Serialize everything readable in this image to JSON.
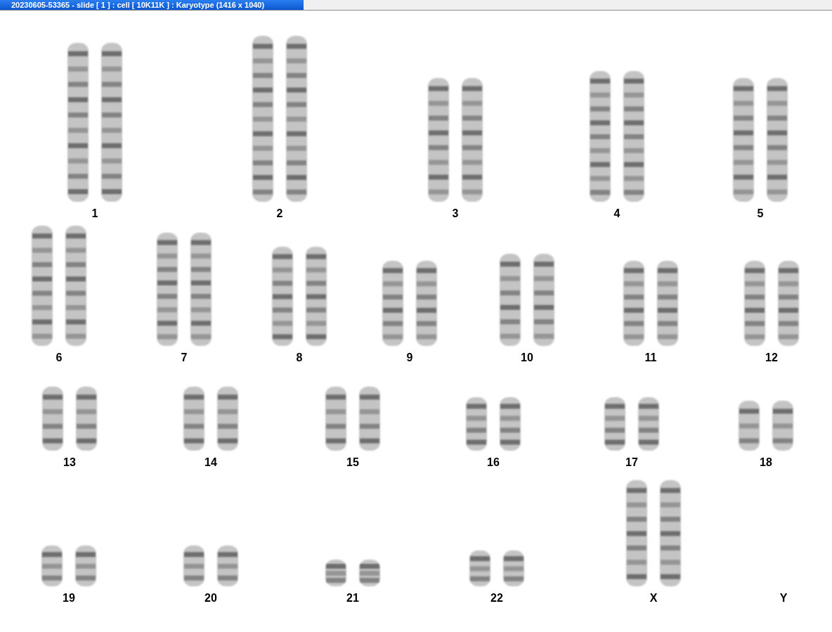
{
  "window": {
    "title": "20230605-53365 - slide [ 1 ] : cell [ 10K11K ] : Karyotype  (1416 x 1040)"
  },
  "karyotype": {
    "rows": [
      {
        "pairs": [
          {
            "label": "1",
            "kind": "pair"
          },
          {
            "label": "2",
            "kind": "pair"
          },
          {
            "label": "3",
            "kind": "pair"
          },
          {
            "label": "4",
            "kind": "pair"
          },
          {
            "label": "5",
            "kind": "pair"
          }
        ]
      },
      {
        "pairs": [
          {
            "label": "6",
            "kind": "pair"
          },
          {
            "label": "7",
            "kind": "pair"
          },
          {
            "label": "8",
            "kind": "pair"
          },
          {
            "label": "9",
            "kind": "pair"
          },
          {
            "label": "10",
            "kind": "pair"
          },
          {
            "label": "11",
            "kind": "pair"
          },
          {
            "label": "12",
            "kind": "pair"
          }
        ]
      },
      {
        "pairs": [
          {
            "label": "13",
            "kind": "pair"
          },
          {
            "label": "14",
            "kind": "pair"
          },
          {
            "label": "15",
            "kind": "pair"
          },
          {
            "label": "16",
            "kind": "pair"
          },
          {
            "label": "17",
            "kind": "pair"
          },
          {
            "label": "18",
            "kind": "pair"
          }
        ]
      },
      {
        "pairs": [
          {
            "label": "19",
            "kind": "pair"
          },
          {
            "label": "20",
            "kind": "pair"
          },
          {
            "label": "21",
            "kind": "pair"
          },
          {
            "label": "22",
            "kind": "pair"
          },
          {
            "label": "X",
            "kind": "pair"
          },
          {
            "label": "Y",
            "kind": "empty"
          }
        ]
      }
    ]
  }
}
